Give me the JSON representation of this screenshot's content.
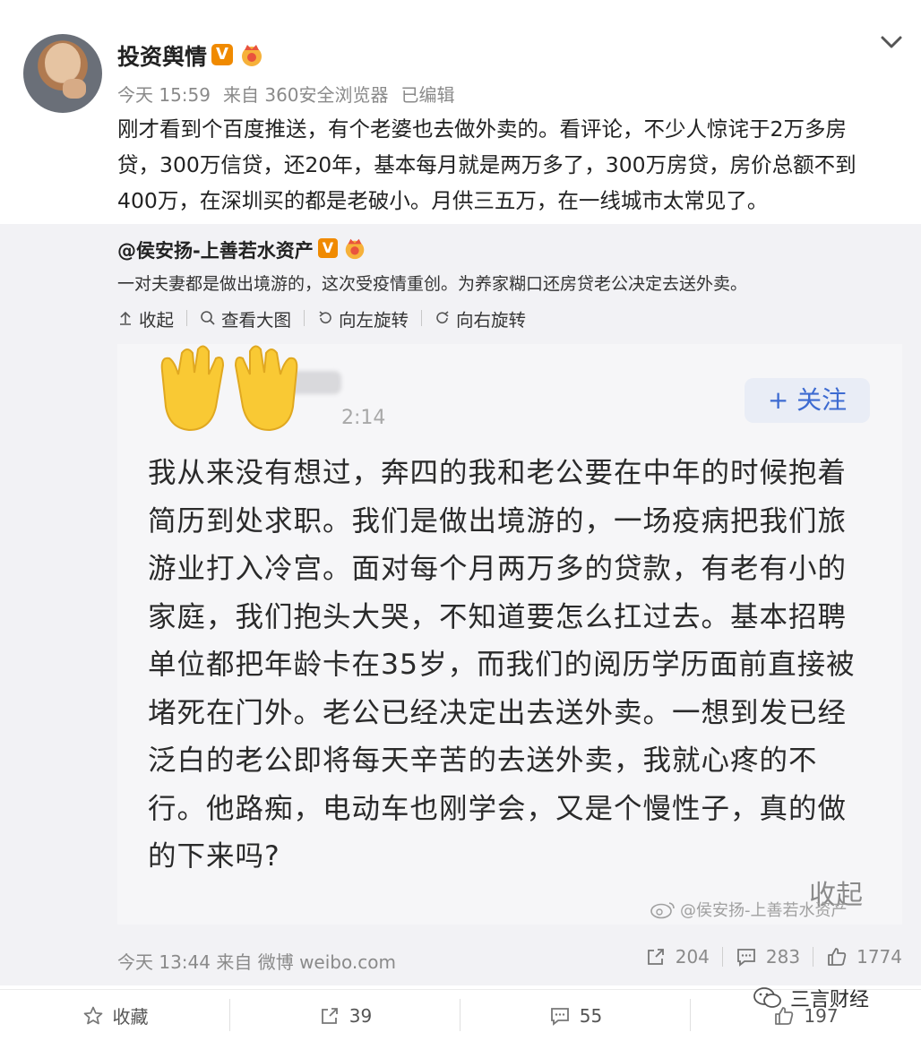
{
  "post": {
    "username": "投资舆情",
    "v_badge": "V",
    "time": "今天 15:59",
    "source": "来自 360安全浏览器",
    "edited": "已编辑",
    "text": "刚才看到个百度推送，有个老婆也去做外卖的。看评论，不少人惊诧于2万多房贷，300万信贷，还20年，基本每月就是两万多了，300万房贷，房价总额不到400万，在深圳买的都是老破小。月供三五万，在一线城市太常见了。"
  },
  "repost": {
    "username": "@侯安扬-上善若水资产",
    "v_badge": "V",
    "text": "一对夫妻都是做出境游的，这次受疫情重创。为养家糊口还房贷老公决定去送外卖。",
    "toolbar": {
      "collapse": "收起",
      "view_large": "查看大图",
      "rotate_left": "向左旋转",
      "rotate_right": "向右旋转"
    },
    "image": {
      "time_fragment": "2:14",
      "follow": "+ 关注",
      "body": "我从来没有想过，奔四的我和老公要在中年的时候抱着简历到处求职。我们是做出境游的，一场疫病把我们旅游业打入冷宫。面对每个月两万多的贷款，有老有小的家庭，我们抱头大哭，不知道要怎么扛过去。基本招聘单位都把年龄卡在35岁，而我们的阅历学历面前直接被堵死在门外。老公已经决定出去送外卖。一想到发已经泛白的老公即将每天辛苦的去送外卖，我就心疼的不行。他路痴，电动车也刚学会，又是个慢性子，真的做的下来吗?",
      "collapse": "收起",
      "watermark": "@侯安扬-上善若水资产"
    },
    "footer": {
      "time": "今天 13:44",
      "source": "来自 微博 weibo.com",
      "reposts": "204",
      "comments": "283",
      "likes": "1774"
    }
  },
  "actions": {
    "favorite": "收藏",
    "repost_count": "39",
    "comment_count": "55",
    "like_count": "197"
  },
  "wechat_watermark": "三言财经",
  "colors": {
    "v_badge": "#f08a00",
    "follow_text": "#3d6bd1",
    "repost_bg": "#f2f2f5"
  }
}
